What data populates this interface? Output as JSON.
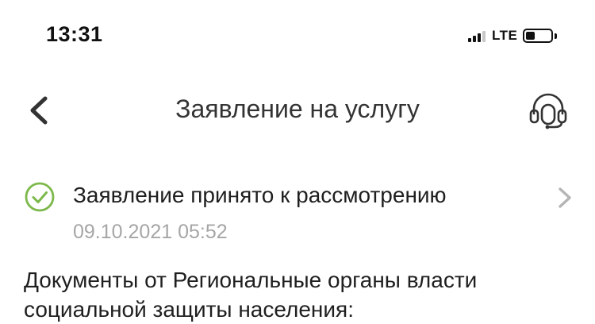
{
  "status_bar": {
    "time": "13:31",
    "network": "LTE",
    "signal_icon": "cellular-signal-icon",
    "battery_icon": "battery-low-icon",
    "battery_level": 0.25
  },
  "nav": {
    "title": "Заявление на услугу",
    "back_icon": "chevron-left-icon",
    "support_icon": "headset-icon"
  },
  "application_status": {
    "label": "Заявление принято к рассмотрению",
    "date": "09.10.2021 05:52",
    "status_icon": "check-circle-icon",
    "status_color": "#7cb84a",
    "arrow_icon": "chevron-right-icon"
  },
  "documents": {
    "text": "Документы от Региональные органы власти социальной защиты населения:"
  }
}
